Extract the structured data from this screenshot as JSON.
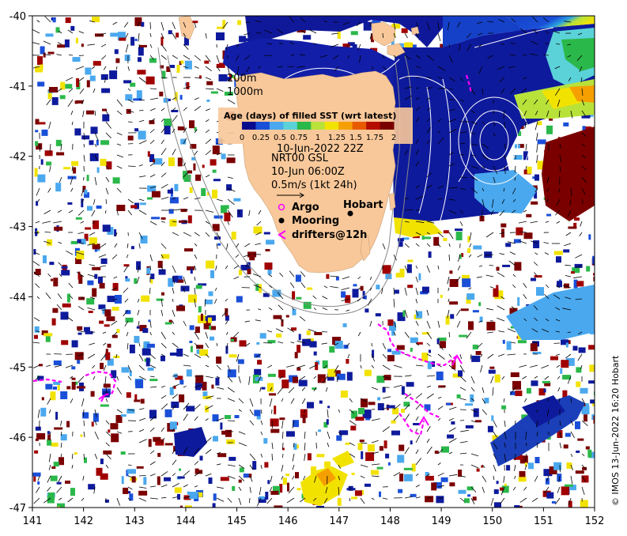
{
  "map": {
    "x_ticks": [
      "141",
      "142",
      "143",
      "144",
      "145",
      "146",
      "147",
      "148",
      "149",
      "150",
      "151",
      "152"
    ],
    "y_ticks": [
      "-40",
      "-41",
      "-42",
      "-43",
      "-44",
      "-45",
      "-46",
      "-47"
    ],
    "xlim": [
      141,
      152
    ],
    "ylim": [
      -47,
      -40
    ]
  },
  "contours": {
    "label_200m": "200m",
    "label_1000m": "1000m"
  },
  "colorbar": {
    "title": "Age (days) of filled SST (wrt latest)",
    "ticks": [
      "0",
      "0.25",
      "0.5",
      "0.75",
      "1",
      "1.25",
      "1.5",
      "1.75",
      "2"
    ],
    "colors": [
      "#0a0a8c",
      "#1a4fd8",
      "#4aa8ee",
      "#5ad2d8",
      "#2bb84a",
      "#b8e23a",
      "#f2e200",
      "#f5a000",
      "#e85a00",
      "#b40d00",
      "#7a0000"
    ]
  },
  "info": {
    "sst_date": "10-Jun-2022 22Z",
    "current_source": "NRT00 GSL",
    "current_date": "10-Jun 06:00Z",
    "scale_label": "0.5m/s (1kt 24h)"
  },
  "legend": {
    "argo": "Argo",
    "mooring": "Mooring",
    "drifters": "drifters@12h"
  },
  "places": {
    "hobart": "Hobart"
  },
  "credit": "© IMOS 13-Jun-2022 16:20 Hobart",
  "colors": {
    "land": "#f8c89a",
    "drifter": "#ff00ff"
  }
}
